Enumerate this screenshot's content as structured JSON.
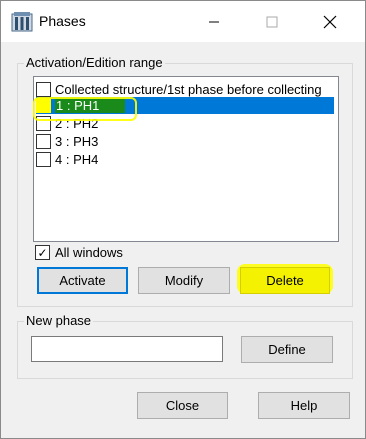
{
  "window": {
    "title": "Phases",
    "app_icon": "columns-app-icon",
    "controls": {
      "minimize": "—",
      "maximize": "☐",
      "close": "✕"
    }
  },
  "activation": {
    "label": "Activation/Edition range",
    "items": [
      {
        "label": "Collected structure/1st phase before collecting",
        "checked": false,
        "selected": false
      },
      {
        "label": "1 : PH1",
        "checked": false,
        "selected": true
      },
      {
        "label": "2 : PH2",
        "checked": false,
        "selected": false
      },
      {
        "label": "3 : PH3",
        "checked": false,
        "selected": false
      },
      {
        "label": "4 : PH4",
        "checked": false,
        "selected": false
      }
    ],
    "all_windows_label": "All windows",
    "all_windows_checked": true,
    "buttons": {
      "activate": "Activate",
      "modify": "Modify",
      "delete": "Delete"
    }
  },
  "new_phase": {
    "label": "New phase",
    "input_value": "",
    "define_label": "Define"
  },
  "footer": {
    "close": "Close",
    "help": "Help"
  },
  "colors": {
    "selection": "#0078d7",
    "highlight": "#ffff00",
    "default_border": "#0078d7"
  }
}
